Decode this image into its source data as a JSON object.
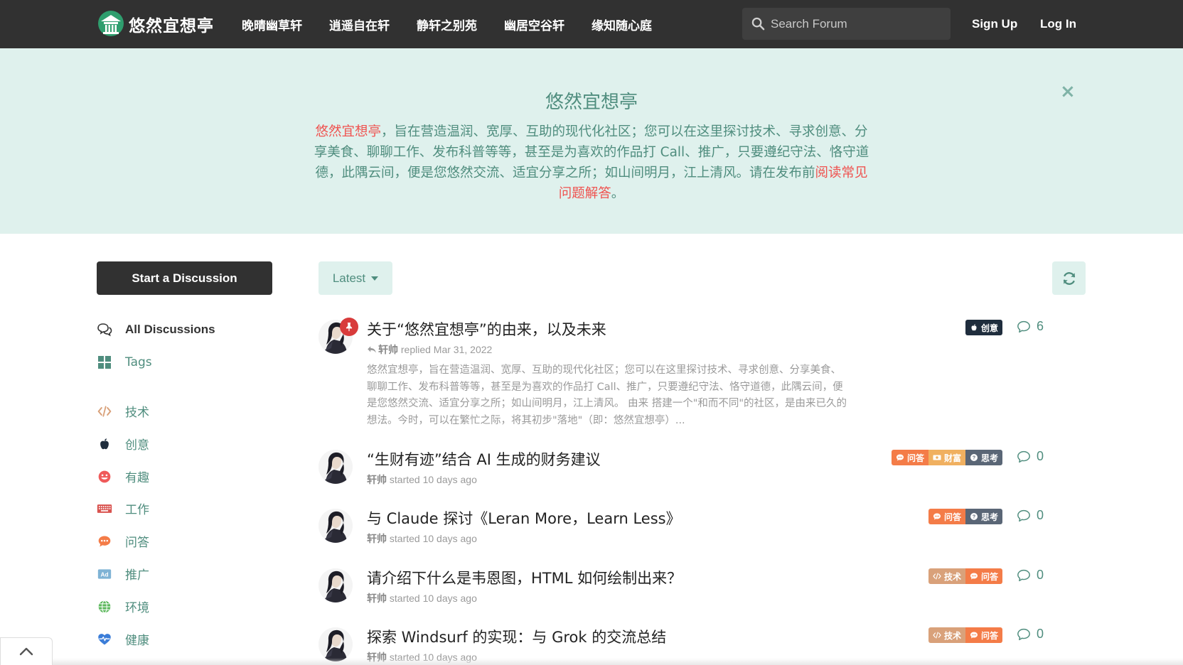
{
  "header": {
    "logo_text": "悠然宜想亭",
    "nav": [
      "晚晴幽草轩",
      "逍遥自在轩",
      "静轩之别苑",
      "幽居空谷轩",
      "缘知随心庭"
    ],
    "search_placeholder": "Search Forum",
    "sign_up": "Sign Up",
    "log_in": "Log In"
  },
  "hero": {
    "title": "悠然宜想亭",
    "close": "×",
    "body_highlight": "悠然宜想亭",
    "body_text": "，旨在营造温润、宽厚、互助的现代化社区；您可以在这里探讨技术、寻求创意、分享美食、聊聊工作、发布科普等等，甚至是为喜欢的作品打 Call、推广，只要遵纪守法、恪守道德，此隅云间，便是您悠然交流、适宜分享之所；如山间明月，江上清风。请在发布前",
    "body_link": "阅读常见问题解答",
    "body_end": "。"
  },
  "sidebar": {
    "start_button": "Start a Discussion",
    "all_discussions": "All Discussions",
    "tags_label": "Tags",
    "tag_items": [
      {
        "label": "技术",
        "icon": "code-icon",
        "color": "#d9a17a"
      },
      {
        "label": "创意",
        "icon": "apple-icon",
        "color": "#1f2d3d"
      },
      {
        "label": "有趣",
        "icon": "smile-icon",
        "color": "#ef5a5a"
      },
      {
        "label": "工作",
        "icon": "keyboard-icon",
        "color": "#d9534f"
      },
      {
        "label": "问答",
        "icon": "comment-dots-icon",
        "color": "#f47c48"
      },
      {
        "label": "推广",
        "icon": "ad-icon",
        "color": "#7fb3d5"
      },
      {
        "label": "环境",
        "icon": "globe-icon",
        "color": "#5cb85c"
      },
      {
        "label": "健康",
        "icon": "heartbeat-icon",
        "color": "#3b7dd8"
      }
    ]
  },
  "toolbar": {
    "sort_label": "Latest"
  },
  "colors": {
    "accent": "#4f8d7e",
    "hero_bg": "#dff1ed",
    "header_bg": "#313131",
    "highlight": "#ef5350"
  },
  "discussions": [
    {
      "title": "关于“悠然宜想亭”的由来，以及未来",
      "pinned": true,
      "meta_user": "轩帅",
      "meta_action": " replied Mar 31, 2022",
      "excerpt": "悠然宜想亭，旨在营造温润、宽厚、互助的现代化社区；您可以在这里探讨技术、寻求创意、分享美食、聊聊工作、发布科普等等，甚至是为喜欢的作品打 Call、推广，只要遵纪守法、恪守道德，此隅云间，便是您悠然交流、适宜分享之所；如山间明月，江上清风。 由来 搭建一个\"和而不同\"的社区，是由来已久的想法。今时，可以在繁忙之际，将其初步\"落地\"（即：悠然宜想亭）...",
      "tags": [
        {
          "label": "创意",
          "icon": "apple-icon",
          "color": "#1f2d3d"
        }
      ],
      "replies": "6"
    },
    {
      "title": "“生财有迹”结合 AI 生成的财务建议",
      "pinned": false,
      "meta_user": "轩帅",
      "meta_action": " started 10 days ago",
      "excerpt": "",
      "tags": [
        {
          "label": "问答",
          "icon": "comment-dots-icon",
          "color": "#f47c48"
        },
        {
          "label": "财富",
          "icon": "money-icon",
          "color": "#f0b060"
        },
        {
          "label": "思考",
          "icon": "question-icon",
          "color": "#5a6676"
        }
      ],
      "replies": "0"
    },
    {
      "title": "与 Claude 探讨《Leran More，Learn Less》",
      "pinned": false,
      "meta_user": "轩帅",
      "meta_action": " started 10 days ago",
      "excerpt": "",
      "tags": [
        {
          "label": "问答",
          "icon": "comment-dots-icon",
          "color": "#f47c48"
        },
        {
          "label": "思考",
          "icon": "question-icon",
          "color": "#5a6676"
        }
      ],
      "replies": "0"
    },
    {
      "title": "请介绍下什么是韦恩图，HTML 如何绘制出来？",
      "pinned": false,
      "meta_user": "轩帅",
      "meta_action": " started 10 days ago",
      "excerpt": "",
      "tags": [
        {
          "label": "技术",
          "icon": "code-icon",
          "color": "#d9a17a"
        },
        {
          "label": "问答",
          "icon": "comment-dots-icon",
          "color": "#f47c48"
        }
      ],
      "replies": "0"
    },
    {
      "title": "探索 Windsurf 的实现：与 Grok 的交流总结",
      "pinned": false,
      "meta_user": "轩帅",
      "meta_action": " started 10 days ago",
      "excerpt": "",
      "tags": [
        {
          "label": "技术",
          "icon": "code-icon",
          "color": "#d9a17a"
        },
        {
          "label": "问答",
          "icon": "comment-dots-icon",
          "color": "#f47c48"
        }
      ],
      "replies": "0"
    }
  ]
}
